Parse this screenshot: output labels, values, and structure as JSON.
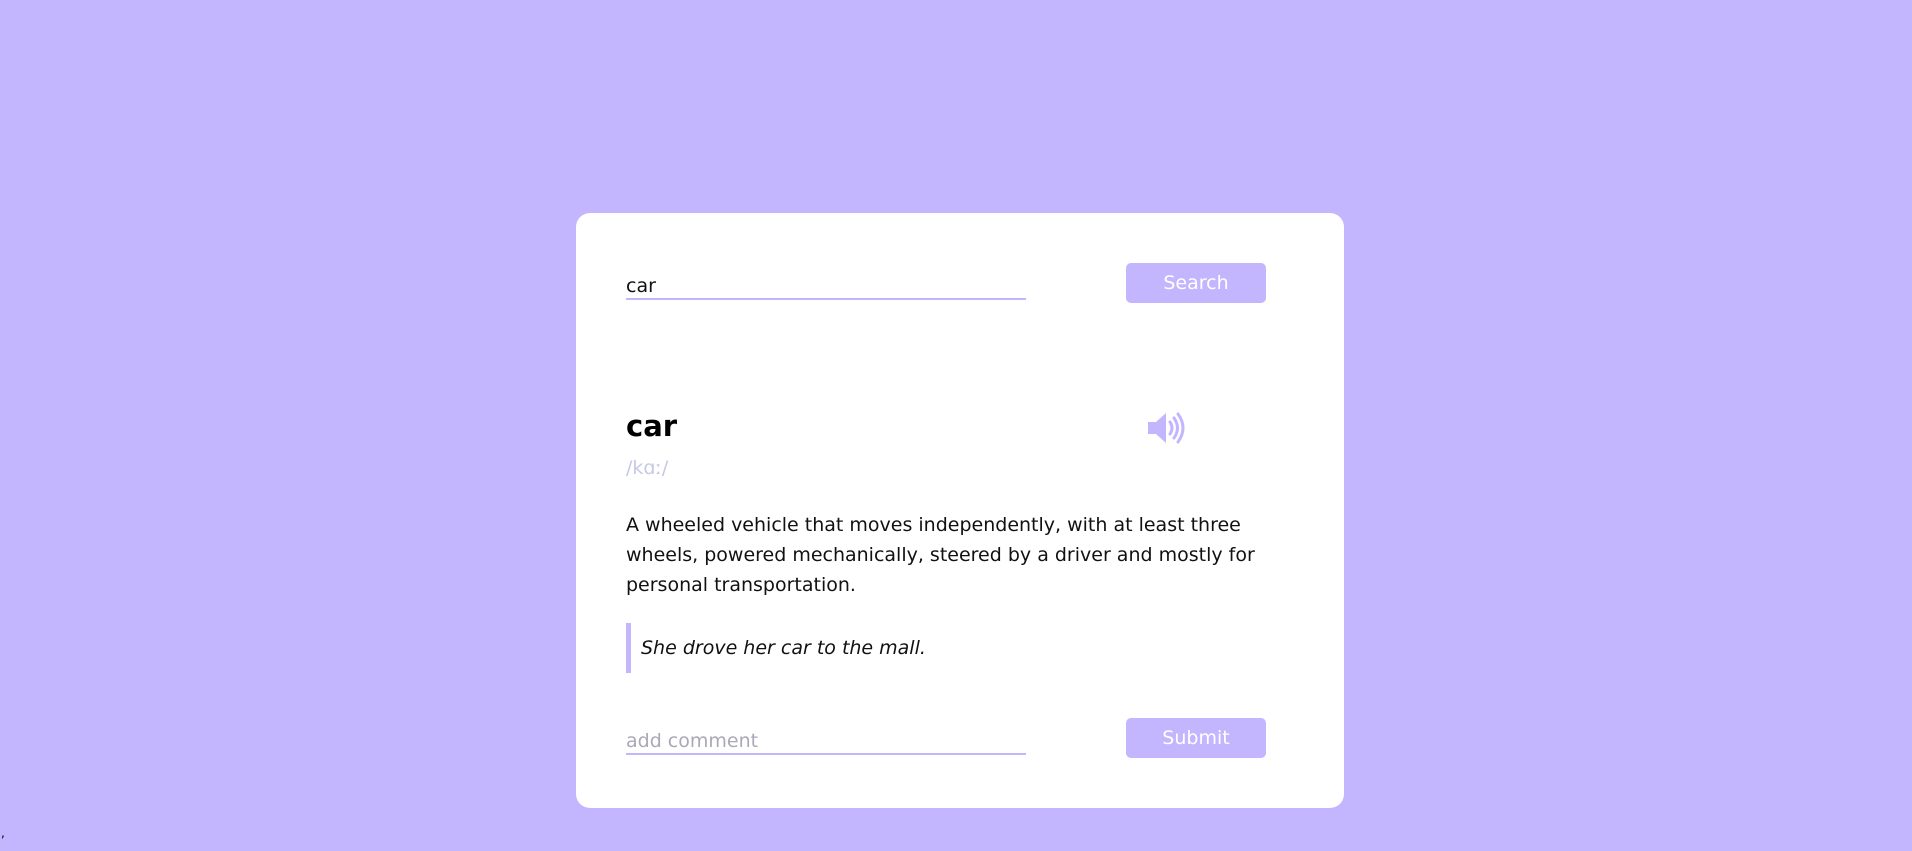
{
  "search": {
    "value": "car",
    "button_label": "Search"
  },
  "result": {
    "word": "car",
    "phonetic": "/kɑː/",
    "sound_icon": "speaker-wave-icon",
    "meaning": "A wheeled vehicle that moves independently, with at least three wheels, powered mechanically, steered by a driver and mostly for personal transportation.",
    "example": "She drove her car to the mall."
  },
  "comment": {
    "placeholder": "add comment",
    "value": "",
    "button_label": "Submit"
  },
  "stray_mark": ",",
  "colors": {
    "background": "#c4b6fe",
    "accent": "#c4b6fe",
    "card": "#ffffff",
    "phonetic": "#c7c7e6"
  }
}
